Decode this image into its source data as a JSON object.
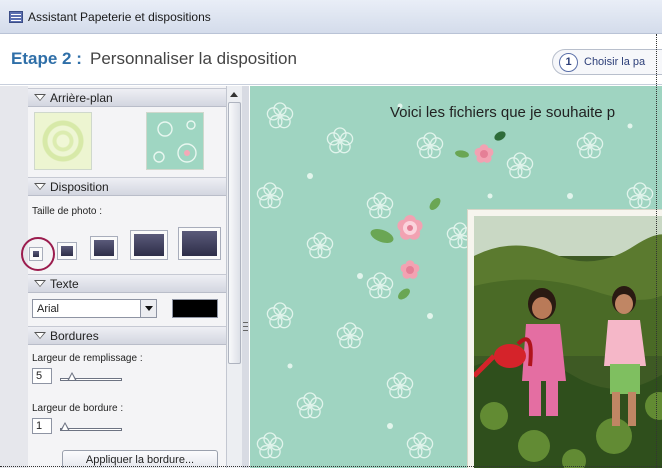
{
  "window": {
    "title": "Assistant Papeterie et dispositions"
  },
  "step": {
    "label": "Etape 2",
    "separator": ":",
    "name": "Personnaliser la disposition",
    "pill_number": "1",
    "pill_text": "Choisir la pa"
  },
  "panel": {
    "background_section": "Arrière-plan",
    "layout_section": "Disposition",
    "photo_size_label": "Taille de photo :",
    "text_section": "Texte",
    "font_value": "Arial",
    "text_color": "#000000",
    "borders_section": "Bordures",
    "fill_width_label": "Largeur de remplissage :",
    "fill_width_value": "5",
    "border_width_label": "Largeur de bordure :",
    "border_width_value": "1",
    "apply_border_button": "Appliquer la bordure..."
  },
  "canvas": {
    "headline": "Voici les fichiers que je souhaite p",
    "background_color": "#9fd4c1"
  },
  "colors": {
    "accent": "#2f6fa8",
    "highlight_circle": "#9b1c4e"
  }
}
